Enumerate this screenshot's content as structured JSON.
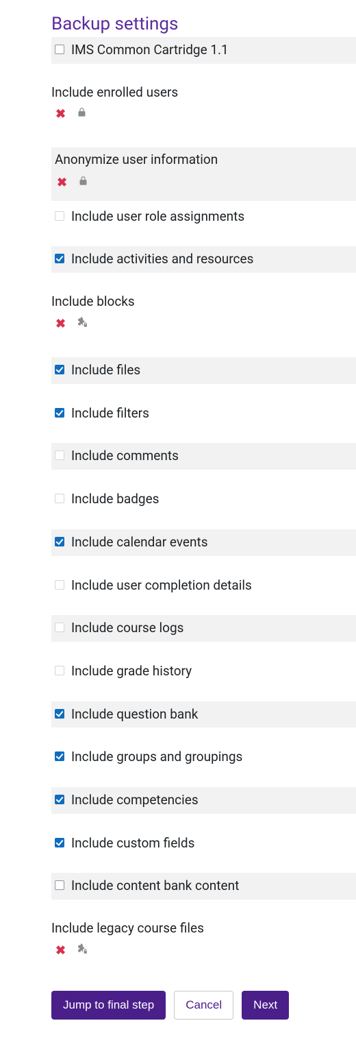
{
  "heading": "Backup settings",
  "rows": [
    {
      "id": "ims",
      "type": "check",
      "label": "IMS Common Cartridge 1.1",
      "checked": false,
      "odd": true,
      "light": false
    },
    {
      "id": "gap1",
      "type": "gap"
    },
    {
      "id": "enrolled-label",
      "type": "label",
      "label": "Include enrolled users"
    },
    {
      "id": "enrolled-status",
      "type": "status",
      "icon2": "lock",
      "odd": false
    },
    {
      "id": "gap2",
      "type": "gap"
    },
    {
      "id": "anon-label",
      "type": "label",
      "label": "Anonymize user information",
      "odd": true
    },
    {
      "id": "anon-status",
      "type": "status",
      "icon2": "lock",
      "odd": true
    },
    {
      "id": "gap3",
      "type": "gapsm"
    },
    {
      "id": "role",
      "type": "check",
      "label": "Include user role assignments",
      "checked": false,
      "odd": false,
      "light": true
    },
    {
      "id": "gap4",
      "type": "gap"
    },
    {
      "id": "activities",
      "type": "check",
      "label": "Include activities and resources",
      "checked": true,
      "odd": true
    },
    {
      "id": "gap5",
      "type": "gap"
    },
    {
      "id": "blocks-label",
      "type": "label",
      "label": "Include blocks"
    },
    {
      "id": "blocks-status",
      "type": "status",
      "icon2": "locksite",
      "odd": false
    },
    {
      "id": "gap6",
      "type": "gap"
    },
    {
      "id": "files",
      "type": "check",
      "label": "Include files",
      "checked": true,
      "odd": true
    },
    {
      "id": "gap7",
      "type": "gap"
    },
    {
      "id": "filters",
      "type": "check",
      "label": "Include filters",
      "checked": true,
      "odd": false
    },
    {
      "id": "gap8",
      "type": "gap"
    },
    {
      "id": "comments",
      "type": "check",
      "label": "Include comments",
      "checked": false,
      "odd": true,
      "light": true
    },
    {
      "id": "gap9",
      "type": "gap"
    },
    {
      "id": "badges",
      "type": "check",
      "label": "Include badges",
      "checked": false,
      "odd": false,
      "light": true
    },
    {
      "id": "gap10",
      "type": "gap"
    },
    {
      "id": "calendar",
      "type": "check",
      "label": "Include calendar events",
      "checked": true,
      "odd": true
    },
    {
      "id": "gap11",
      "type": "gap"
    },
    {
      "id": "completion",
      "type": "check",
      "label": "Include user completion details",
      "checked": false,
      "odd": false,
      "light": true
    },
    {
      "id": "gap12",
      "type": "gap"
    },
    {
      "id": "logs",
      "type": "check",
      "label": "Include course logs",
      "checked": false,
      "odd": true,
      "light": true
    },
    {
      "id": "gap13",
      "type": "gap"
    },
    {
      "id": "grade",
      "type": "check",
      "label": "Include grade history",
      "checked": false,
      "odd": false,
      "light": true
    },
    {
      "id": "gap14",
      "type": "gap"
    },
    {
      "id": "question",
      "type": "check",
      "label": "Include question bank",
      "checked": true,
      "odd": true
    },
    {
      "id": "gap15",
      "type": "gap"
    },
    {
      "id": "groups",
      "type": "check",
      "label": "Include groups and groupings",
      "checked": true,
      "odd": false
    },
    {
      "id": "gap16",
      "type": "gap"
    },
    {
      "id": "competencies",
      "type": "check",
      "label": "Include competencies",
      "checked": true,
      "odd": true
    },
    {
      "id": "gap17",
      "type": "gap"
    },
    {
      "id": "custom",
      "type": "check",
      "label": "Include custom fields",
      "checked": true,
      "odd": false
    },
    {
      "id": "gap18",
      "type": "gap"
    },
    {
      "id": "content",
      "type": "check",
      "label": "Include content bank content",
      "checked": false,
      "odd": true
    },
    {
      "id": "gap19",
      "type": "gap"
    },
    {
      "id": "legacy-label",
      "type": "label",
      "label": "Include legacy course files"
    },
    {
      "id": "legacy-status",
      "type": "status",
      "icon2": "locksite",
      "odd": false
    }
  ],
  "buttons": {
    "jump": "Jump to final step",
    "cancel": "Cancel",
    "next": "Next"
  }
}
